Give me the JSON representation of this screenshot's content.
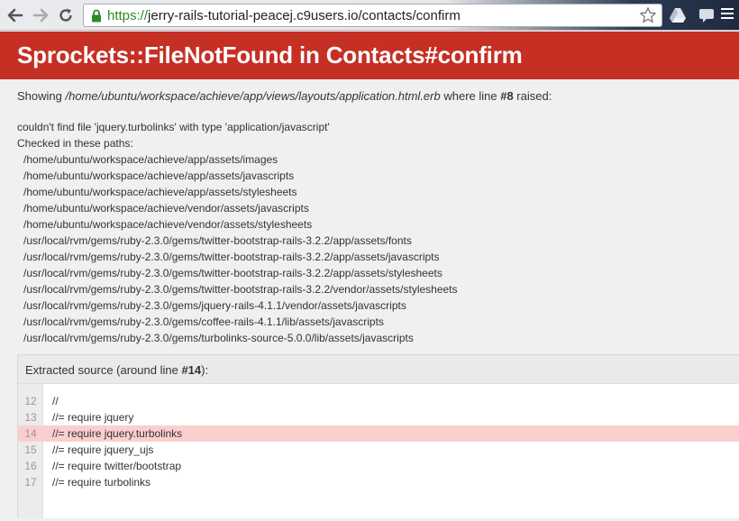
{
  "browser": {
    "url_scheme": "https://",
    "url_rest": "jerry-rails-tutorial-peacej.c9users.io/contacts/confirm",
    "icons": [
      "back-arrow-icon",
      "forward-arrow-icon",
      "reload-icon",
      "lock-icon",
      "star-icon",
      "drive-icon",
      "chat-icon",
      "menu-icon"
    ]
  },
  "error": {
    "title": "Sprockets::FileNotFound in Contacts#confirm",
    "showing_prefix": "Showing ",
    "showing_path": "/home/ubuntu/workspace/achieve/app/views/layouts/application.html.erb",
    "showing_middle": " where line ",
    "showing_line": "#8",
    "showing_suffix": " raised:",
    "message": "couldn't find file 'jquery.turbolinks' with type 'application/javascript'",
    "checked_label": "Checked in these paths:",
    "paths": [
      "/home/ubuntu/workspace/achieve/app/assets/images",
      "/home/ubuntu/workspace/achieve/app/assets/javascripts",
      "/home/ubuntu/workspace/achieve/app/assets/stylesheets",
      "/home/ubuntu/workspace/achieve/vendor/assets/javascripts",
      "/home/ubuntu/workspace/achieve/vendor/assets/stylesheets",
      "/usr/local/rvm/gems/ruby-2.3.0/gems/twitter-bootstrap-rails-3.2.2/app/assets/fonts",
      "/usr/local/rvm/gems/ruby-2.3.0/gems/twitter-bootstrap-rails-3.2.2/app/assets/javascripts",
      "/usr/local/rvm/gems/ruby-2.3.0/gems/twitter-bootstrap-rails-3.2.2/app/assets/stylesheets",
      "/usr/local/rvm/gems/ruby-2.3.0/gems/twitter-bootstrap-rails-3.2.2/vendor/assets/stylesheets",
      "/usr/local/rvm/gems/ruby-2.3.0/gems/jquery-rails-4.1.1/vendor/assets/javascripts",
      "/usr/local/rvm/gems/ruby-2.3.0/gems/coffee-rails-4.1.1/lib/assets/javascripts",
      "/usr/local/rvm/gems/ruby-2.3.0/gems/turbolinks-source-5.0.0/lib/assets/javascripts"
    ]
  },
  "source": {
    "title_prefix": "Extracted source (around line ",
    "title_line": "#14",
    "title_suffix": "):",
    "lines": [
      {
        "num": "12",
        "code": "//",
        "highlight": false
      },
      {
        "num": "13",
        "code": "//= require jquery",
        "highlight": false
      },
      {
        "num": "14",
        "code": "//= require jquery.turbolinks",
        "highlight": true
      },
      {
        "num": "15",
        "code": "//= require jquery_ujs",
        "highlight": false
      },
      {
        "num": "16",
        "code": "//= require twitter/bootstrap",
        "highlight": false
      },
      {
        "num": "17",
        "code": "//= require turbolinks",
        "highlight": false
      }
    ]
  },
  "colors": {
    "header_red": "#c52f24",
    "highlight_pink": "#fccfcf",
    "url_green": "#2e8b22"
  }
}
